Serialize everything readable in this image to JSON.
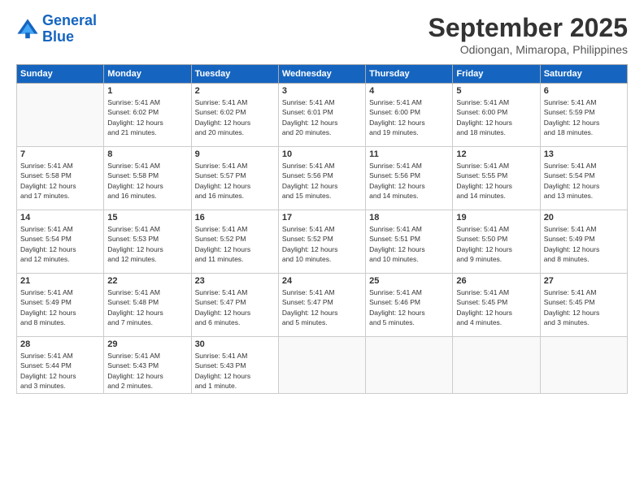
{
  "header": {
    "logo_line1": "General",
    "logo_line2": "Blue",
    "month": "September 2025",
    "location": "Odiongan, Mimaropa, Philippines"
  },
  "days_of_week": [
    "Sunday",
    "Monday",
    "Tuesday",
    "Wednesday",
    "Thursday",
    "Friday",
    "Saturday"
  ],
  "weeks": [
    [
      {
        "num": "",
        "info": ""
      },
      {
        "num": "1",
        "info": "Sunrise: 5:41 AM\nSunset: 6:02 PM\nDaylight: 12 hours\nand 21 minutes."
      },
      {
        "num": "2",
        "info": "Sunrise: 5:41 AM\nSunset: 6:02 PM\nDaylight: 12 hours\nand 20 minutes."
      },
      {
        "num": "3",
        "info": "Sunrise: 5:41 AM\nSunset: 6:01 PM\nDaylight: 12 hours\nand 20 minutes."
      },
      {
        "num": "4",
        "info": "Sunrise: 5:41 AM\nSunset: 6:00 PM\nDaylight: 12 hours\nand 19 minutes."
      },
      {
        "num": "5",
        "info": "Sunrise: 5:41 AM\nSunset: 6:00 PM\nDaylight: 12 hours\nand 18 minutes."
      },
      {
        "num": "6",
        "info": "Sunrise: 5:41 AM\nSunset: 5:59 PM\nDaylight: 12 hours\nand 18 minutes."
      }
    ],
    [
      {
        "num": "7",
        "info": "Sunrise: 5:41 AM\nSunset: 5:58 PM\nDaylight: 12 hours\nand 17 minutes."
      },
      {
        "num": "8",
        "info": "Sunrise: 5:41 AM\nSunset: 5:58 PM\nDaylight: 12 hours\nand 16 minutes."
      },
      {
        "num": "9",
        "info": "Sunrise: 5:41 AM\nSunset: 5:57 PM\nDaylight: 12 hours\nand 16 minutes."
      },
      {
        "num": "10",
        "info": "Sunrise: 5:41 AM\nSunset: 5:56 PM\nDaylight: 12 hours\nand 15 minutes."
      },
      {
        "num": "11",
        "info": "Sunrise: 5:41 AM\nSunset: 5:56 PM\nDaylight: 12 hours\nand 14 minutes."
      },
      {
        "num": "12",
        "info": "Sunrise: 5:41 AM\nSunset: 5:55 PM\nDaylight: 12 hours\nand 14 minutes."
      },
      {
        "num": "13",
        "info": "Sunrise: 5:41 AM\nSunset: 5:54 PM\nDaylight: 12 hours\nand 13 minutes."
      }
    ],
    [
      {
        "num": "14",
        "info": "Sunrise: 5:41 AM\nSunset: 5:54 PM\nDaylight: 12 hours\nand 12 minutes."
      },
      {
        "num": "15",
        "info": "Sunrise: 5:41 AM\nSunset: 5:53 PM\nDaylight: 12 hours\nand 12 minutes."
      },
      {
        "num": "16",
        "info": "Sunrise: 5:41 AM\nSunset: 5:52 PM\nDaylight: 12 hours\nand 11 minutes."
      },
      {
        "num": "17",
        "info": "Sunrise: 5:41 AM\nSunset: 5:52 PM\nDaylight: 12 hours\nand 10 minutes."
      },
      {
        "num": "18",
        "info": "Sunrise: 5:41 AM\nSunset: 5:51 PM\nDaylight: 12 hours\nand 10 minutes."
      },
      {
        "num": "19",
        "info": "Sunrise: 5:41 AM\nSunset: 5:50 PM\nDaylight: 12 hours\nand 9 minutes."
      },
      {
        "num": "20",
        "info": "Sunrise: 5:41 AM\nSunset: 5:49 PM\nDaylight: 12 hours\nand 8 minutes."
      }
    ],
    [
      {
        "num": "21",
        "info": "Sunrise: 5:41 AM\nSunset: 5:49 PM\nDaylight: 12 hours\nand 8 minutes."
      },
      {
        "num": "22",
        "info": "Sunrise: 5:41 AM\nSunset: 5:48 PM\nDaylight: 12 hours\nand 7 minutes."
      },
      {
        "num": "23",
        "info": "Sunrise: 5:41 AM\nSunset: 5:47 PM\nDaylight: 12 hours\nand 6 minutes."
      },
      {
        "num": "24",
        "info": "Sunrise: 5:41 AM\nSunset: 5:47 PM\nDaylight: 12 hours\nand 5 minutes."
      },
      {
        "num": "25",
        "info": "Sunrise: 5:41 AM\nSunset: 5:46 PM\nDaylight: 12 hours\nand 5 minutes."
      },
      {
        "num": "26",
        "info": "Sunrise: 5:41 AM\nSunset: 5:45 PM\nDaylight: 12 hours\nand 4 minutes."
      },
      {
        "num": "27",
        "info": "Sunrise: 5:41 AM\nSunset: 5:45 PM\nDaylight: 12 hours\nand 3 minutes."
      }
    ],
    [
      {
        "num": "28",
        "info": "Sunrise: 5:41 AM\nSunset: 5:44 PM\nDaylight: 12 hours\nand 3 minutes."
      },
      {
        "num": "29",
        "info": "Sunrise: 5:41 AM\nSunset: 5:43 PM\nDaylight: 12 hours\nand 2 minutes."
      },
      {
        "num": "30",
        "info": "Sunrise: 5:41 AM\nSunset: 5:43 PM\nDaylight: 12 hours\nand 1 minute."
      },
      {
        "num": "",
        "info": ""
      },
      {
        "num": "",
        "info": ""
      },
      {
        "num": "",
        "info": ""
      },
      {
        "num": "",
        "info": ""
      }
    ]
  ]
}
